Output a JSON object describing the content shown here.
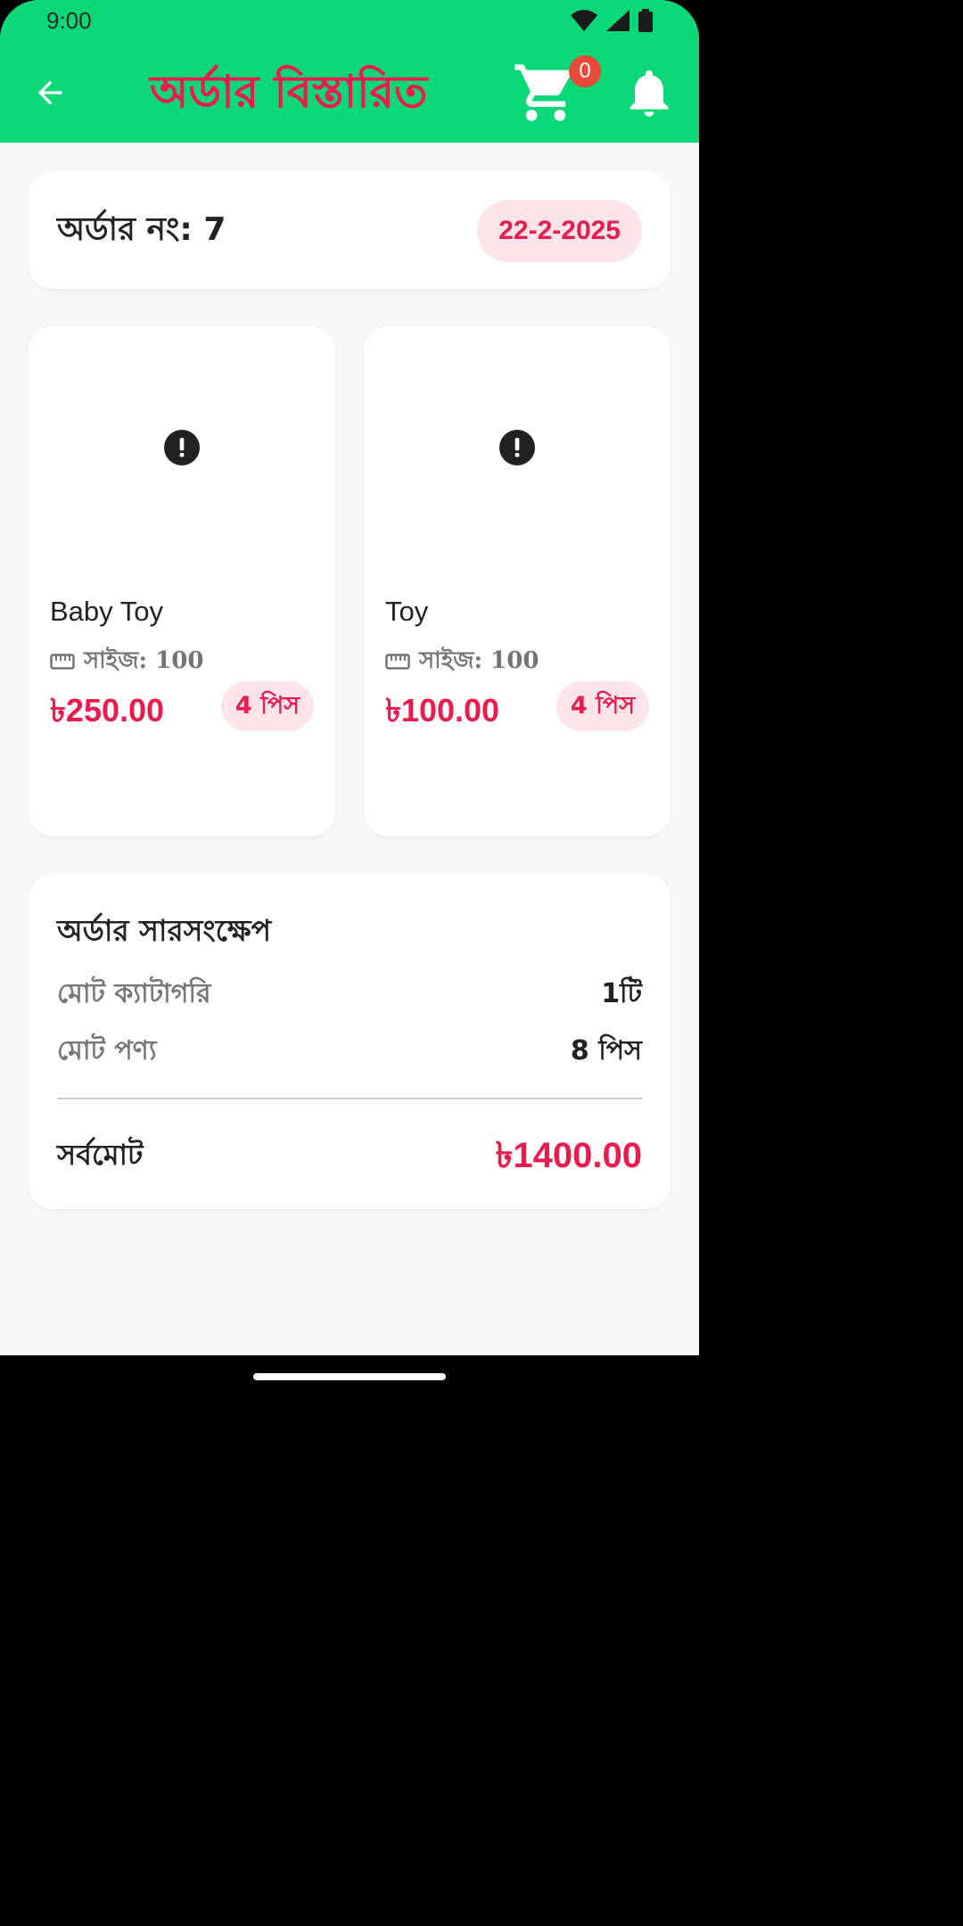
{
  "status": {
    "time": "9:00"
  },
  "header": {
    "title": "অর্ডার বিস্তারিত",
    "cart_count": "0"
  },
  "order": {
    "number_label": "অর্ডার নং: 7",
    "date": "22-2-2025"
  },
  "products": [
    {
      "name": "Baby Toy",
      "size": "সাইজ: 100",
      "price": "৳250.00",
      "qty": "4 পিস"
    },
    {
      "name": "Toy",
      "size": "সাইজ: 100",
      "price": "৳100.00",
      "qty": "4 পিস"
    }
  ],
  "summary": {
    "title": "অর্ডার সারসংক্ষেপ",
    "rows": [
      {
        "label": "মোট ক্যাটাগরি",
        "value": "1টি"
      },
      {
        "label": "মোট পণ্য",
        "value": "8 পিস"
      }
    ],
    "total_label": "সর্বমোট",
    "total_value": "৳1400.00"
  },
  "colors": {
    "appbar": "#0ad877",
    "accent": "#e81c4f",
    "pill_bg": "#fde4ea"
  },
  "icons": [
    "back-arrow-icon",
    "cart-icon",
    "bell-icon",
    "error-icon",
    "ruler-icon",
    "wifi-icon",
    "signal-icon",
    "battery-icon"
  ]
}
